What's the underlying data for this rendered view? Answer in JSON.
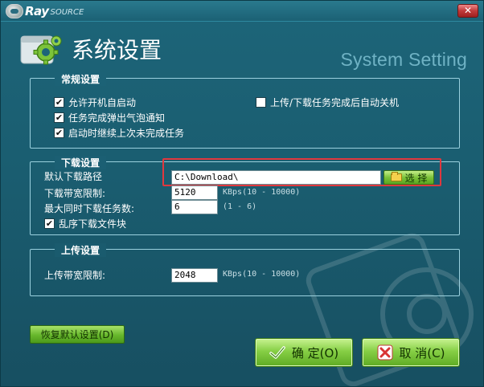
{
  "app": {
    "brand_main": "Ray",
    "brand_sub": "SOURCE",
    "close_label": "✕"
  },
  "header": {
    "title": "系统设置",
    "subtitle": "System Setting"
  },
  "general": {
    "legend": "常规设置",
    "autostart": {
      "label": "允许开机自启动",
      "checked": true
    },
    "bubble_notify": {
      "label": "任务完成弹出气泡通知",
      "checked": true
    },
    "continue_tasks": {
      "label": "启动时继续上次未完成任务",
      "checked": true
    },
    "auto_shutdown": {
      "label": "上传/下载任务完成后自动关机",
      "checked": false
    }
  },
  "download": {
    "legend": "下载设置",
    "path_label": "默认下载路径",
    "path_value": "C:\\Download\\",
    "browse_label": "选 择",
    "bandwidth_label": "下载带宽限制:",
    "bandwidth_value": "5120",
    "bandwidth_hint": "KBps(10 - 10000)",
    "max_tasks_label": "最大同时下载任务数:",
    "max_tasks_value": "6",
    "max_tasks_hint": "(1 - 6)",
    "random_blocks": {
      "label": "乱序下载文件块",
      "checked": true
    }
  },
  "upload": {
    "legend": "上传设置",
    "bandwidth_label": "上传带宽限制:",
    "bandwidth_value": "2048",
    "bandwidth_hint": "KBps(10 - 10000)"
  },
  "buttons": {
    "restore_label": "恢复默认设置(D)",
    "ok_label": "确 定(O)",
    "cancel_label": "取 消(C)"
  },
  "colors": {
    "highlight": "#e0383e",
    "accent_green": "#7cc33a",
    "background": "#1d6579"
  },
  "icons": {
    "header": "settings-gears-icon",
    "browse": "folder-icon",
    "ok": "checkmark-icon",
    "cancel": "x-icon"
  }
}
